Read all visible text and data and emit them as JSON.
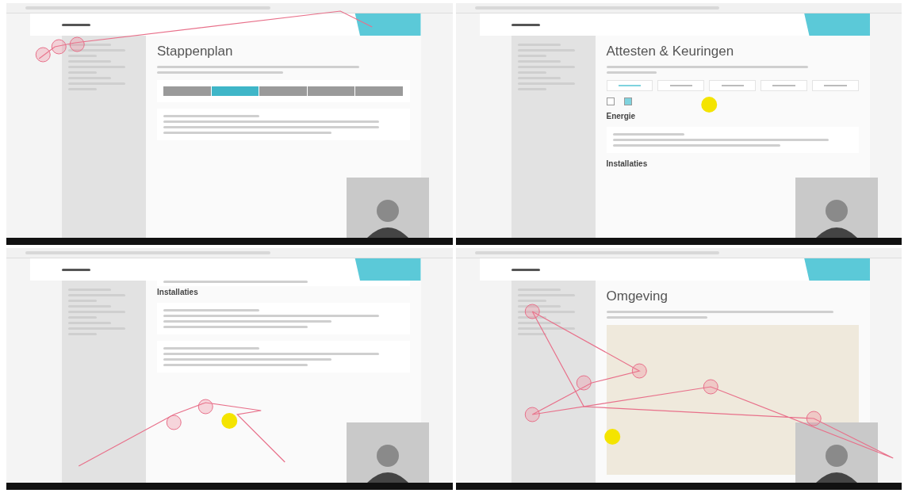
{
  "recordings": [
    {
      "kind": "steps",
      "title": "Stappenplan",
      "steps": [
        {
          "selected": false
        },
        {
          "selected": true
        },
        {
          "selected": false
        },
        {
          "selected": false
        },
        {
          "selected": false
        }
      ]
    },
    {
      "kind": "certificates",
      "title": "Attesten & Keuringen",
      "tabs": [
        {
          "selected": true
        },
        {
          "selected": false
        },
        {
          "selected": false
        },
        {
          "selected": false
        },
        {
          "selected": false
        }
      ],
      "filters": [
        {
          "checked": false
        },
        {
          "checked": true
        }
      ],
      "sections": [
        "Energie",
        "Installaties"
      ]
    },
    {
      "kind": "installations",
      "sections": [
        "Installaties"
      ]
    },
    {
      "kind": "map",
      "title": "Omgeving"
    }
  ]
}
